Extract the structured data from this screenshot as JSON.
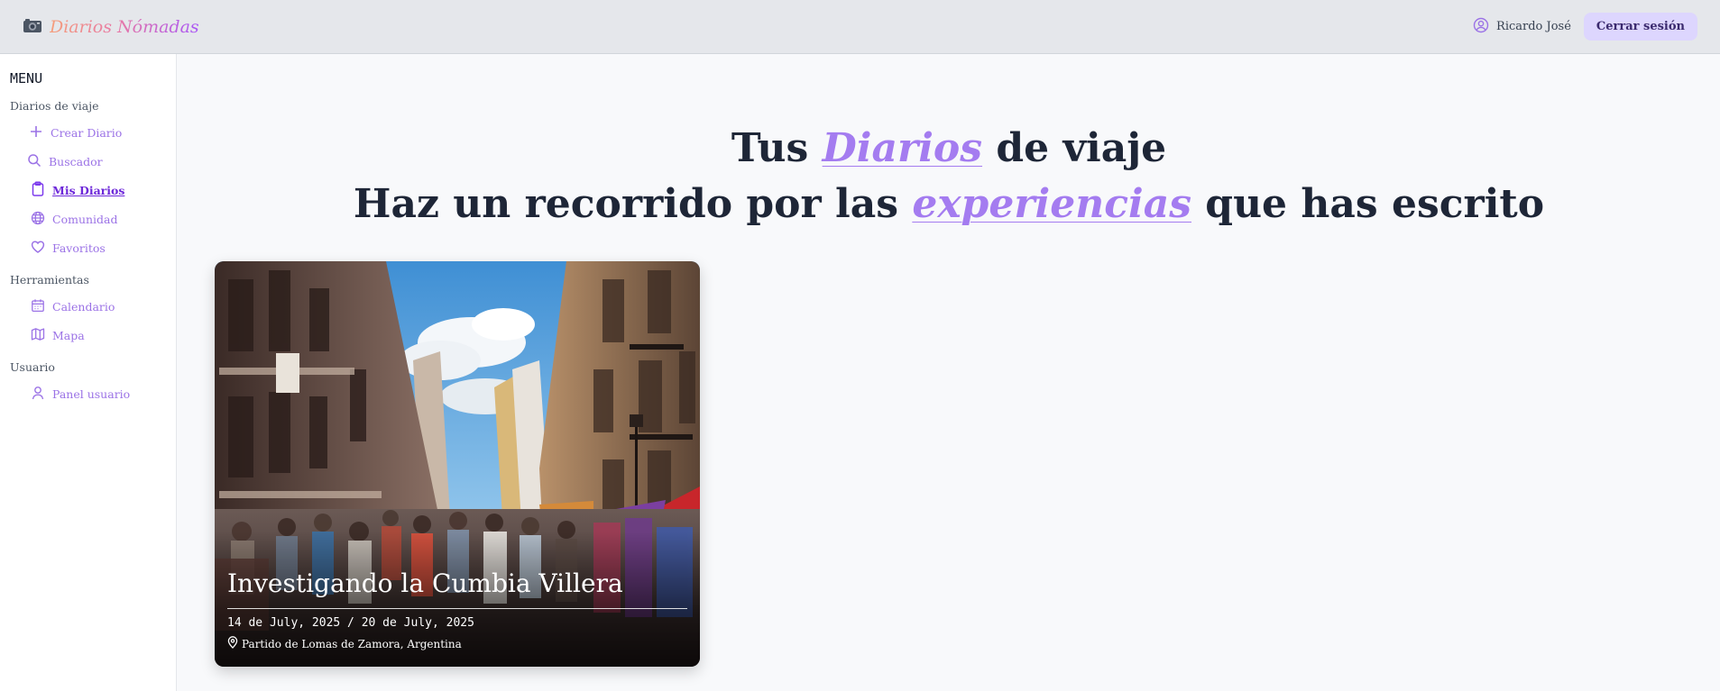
{
  "topbar": {
    "brand": "Diarios Nómadas",
    "brand_icon": "camera-icon",
    "user_name": "Ricardo José",
    "logout_label": "Cerrar sesión"
  },
  "sidebar": {
    "menu_title": "MENU",
    "groups": [
      {
        "title": "Diarios de viaje",
        "items": [
          {
            "label": "Crear Diario",
            "icon": "plus-icon"
          },
          {
            "label": "Buscador",
            "icon": "search-icon"
          },
          {
            "label": "Mis Diarios",
            "icon": "clipboard-icon",
            "active": true
          },
          {
            "label": "Comunidad",
            "icon": "globe-icon"
          },
          {
            "label": "Favoritos",
            "icon": "heart-icon"
          }
        ]
      },
      {
        "title": "Herramientas",
        "items": [
          {
            "label": "Calendario",
            "icon": "calendar-icon"
          },
          {
            "label": "Mapa",
            "icon": "map-icon"
          }
        ]
      },
      {
        "title": "Usuario",
        "items": [
          {
            "label": "Panel usuario",
            "icon": "user-icon"
          }
        ]
      }
    ]
  },
  "headline": {
    "line1_before": "Tus ",
    "line1_accent": "Diarios",
    "line1_after": " de viaje",
    "line2_before": "Haz un recorrido por las ",
    "line2_accent": "experiencias",
    "line2_after": " que has escrito"
  },
  "card": {
    "title": "Investigando la Cumbia Villera",
    "dates": "14 de July, 2025 / 20 de July, 2025",
    "place": "Partido de Lomas de Zamora, Argentina"
  },
  "colors": {
    "accent": "#a47cf0",
    "logout_bg": "#ddd6fe",
    "topbar_bg": "#e5e7eb"
  }
}
